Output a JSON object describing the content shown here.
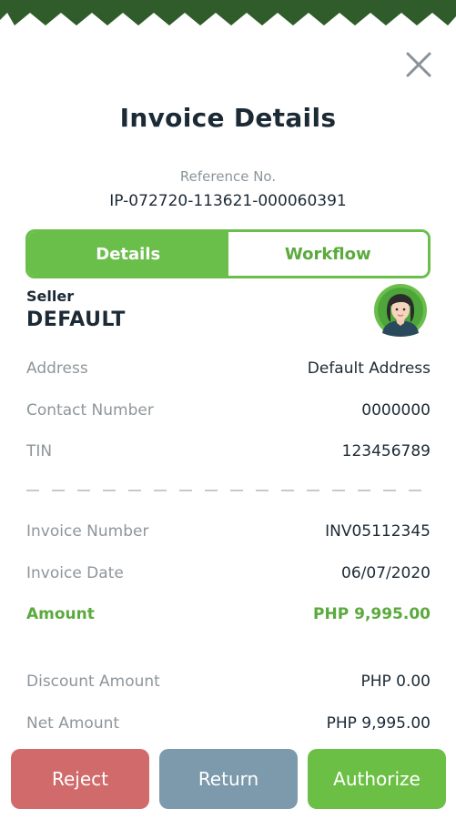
{
  "header": {
    "title": "Invoice Details"
  },
  "reference": {
    "label": "Reference No.",
    "value": "IP-072720-113621-000060391"
  },
  "tabs": [
    {
      "label": "Details",
      "active": true
    },
    {
      "label": "Workflow",
      "active": false
    }
  ],
  "seller": {
    "label": "Seller",
    "name": "DEFAULT",
    "avatar_icon": "female-avatar-icon",
    "details": [
      {
        "label": "Address",
        "value": "Default Address"
      },
      {
        "label": "Contact Number",
        "value": "0000000"
      },
      {
        "label": "TIN",
        "value": "123456789"
      }
    ]
  },
  "invoice": {
    "rows": [
      {
        "label": "Invoice Number",
        "value": "INV05112345"
      },
      {
        "label": "Invoice Date",
        "value": "06/07/2020"
      },
      {
        "label": "Amount",
        "value": "PHP 9,995.00"
      },
      {
        "label": "Discount Amount",
        "value": "PHP 0.00"
      },
      {
        "label": "Net Amount",
        "value": "PHP 9,995.00"
      }
    ]
  },
  "actions": {
    "reject": "Reject",
    "return": "Return",
    "authorize": "Authorize"
  },
  "colors": {
    "brand_dark_green": "#2f5c2a",
    "accent_green": "#6abf4b",
    "reject_red": "#d16b6b",
    "return_slate": "#7c9aac",
    "authorize_green": "#6cbf45"
  }
}
